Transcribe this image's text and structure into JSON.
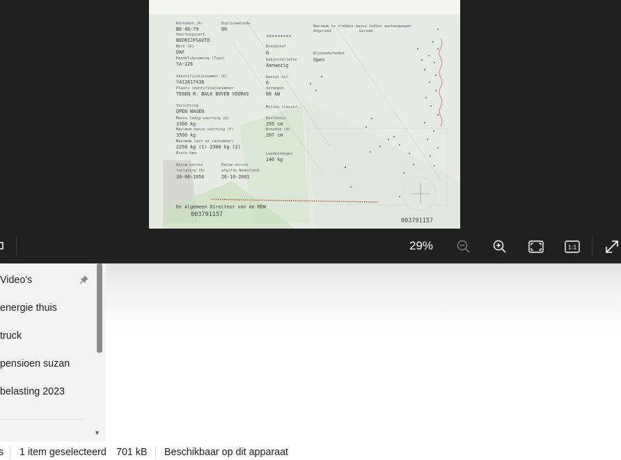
{
  "viewer": {
    "zoom_level": "29%",
    "toolbar_buttons": [
      {
        "name": "zoom-out",
        "icon": "zoom-out-icon"
      },
      {
        "name": "zoom-in",
        "icon": "zoom-in-icon"
      },
      {
        "name": "fit-to-window",
        "icon": "fit-window-icon"
      },
      {
        "name": "actual-size",
        "icon": "actual-size-icon",
        "label": "1:1"
      },
      {
        "name": "full-screen",
        "icon": "expand-icon"
      }
    ]
  },
  "document": {
    "kenteken_label": "Kenteken (A)",
    "kenteken": "BE-46-79",
    "duplicaatcode_label": "Duplicaatcode",
    "duplicaatcode": "00",
    "voertuigsoort_label": "Voertuigsoort",
    "voertuigsoort": "BEDRIJFSAUTO",
    "stars": "*********",
    "merk_label": "Merk (D)",
    "merk": "DAF",
    "brandstof_label": "Brandstof",
    "brandstof": "G",
    "handelsbenaming_label": "Handelsbenaming (Type)",
    "handelsbenaming": "YA-126",
    "gasinstallatie_label": "Gasinstallatie",
    "gasinstallatie": "Aanwezig",
    "bijzonderheden_label": "Bijzonderheden",
    "bijzonderheden": "Open",
    "max_trekken_label": "Maximum te trekken massa indien aanhangwagen",
    "ongeremd_label": "Ongeremd",
    "geremd_label": "Geremd",
    "identificatienummer_label": "Identificatienummer (E)",
    "identificatienummer": "YA12617436",
    "aantal_cil_label": "Aantal cil.",
    "aantal_cil": "6",
    "plaats_id_label": "Plaats identificatienummer",
    "plaats_id": "TEGEN R. BALK BOVEN VOORAS",
    "vermogen_label": "Vermogen",
    "vermogen": "68  kW",
    "inrichting_label": "Inrichting",
    "inrichting": "OPEN WAGEN",
    "milieu_label": "Milieu classif.",
    "massa_ledig_label": "Massa ledig voertuig (G)",
    "massa_ledig": "3360  kg",
    "wielbasis_label": "Wielbasis",
    "wielbasis": "295  cm",
    "max_massa_label": "Maximum massa voertuig (F)",
    "max_massa": "3500  kg",
    "breedte_label": "Breedte (H)",
    "breedte": "207 cm",
    "max_last_label": "Maximum last as (asnummer)",
    "max_last": "2250  kg (1)   2300  kg (2)",
    "bruto_bpm_label": "Bruto bpm",
    "laadvermogen_label": "Laadvermogen",
    "laadvermogen": "140  kg",
    "datum_eerste_label": "Datum eerste",
    "toelating_label": "toelating (B)",
    "datum_eerste": "30-06-1956",
    "datum_eerste2_label": "Datum eerste",
    "afgifte_label": "afgifte Nederland",
    "datum_afgifte": "26-10-2001",
    "directeur": "De Algemeen Directeur van de RDW",
    "serial_left": "003791157",
    "serial_right": "003791157"
  },
  "sidebar": {
    "items": [
      {
        "label": "Video's",
        "pinned": true
      },
      {
        "label": "energie thuis"
      },
      {
        "label": "truck"
      },
      {
        "label": "pensioen suzan"
      },
      {
        "label": "belasting 2023"
      }
    ]
  },
  "statusbar": {
    "items_fragment": "s",
    "selected": "1 item geselecteerd",
    "size": "701 kB",
    "availability": "Beschikbaar op dit apparaat"
  }
}
